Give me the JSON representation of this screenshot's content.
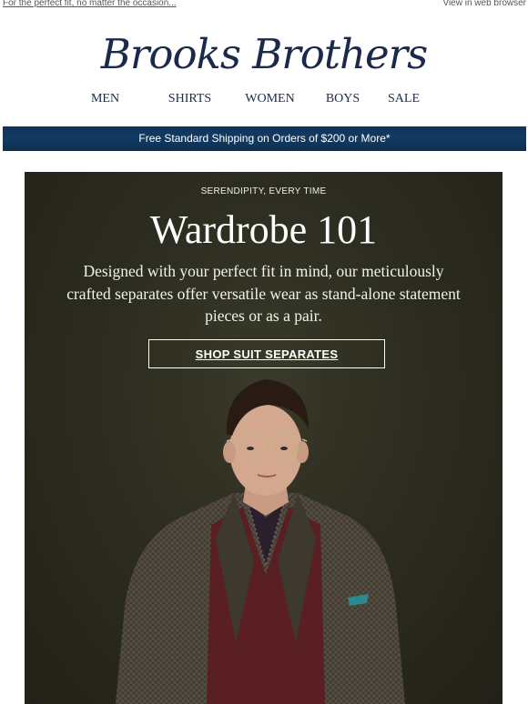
{
  "topbar": {
    "preheader": "For the perfect fit, no matter the occasion...",
    "web_view": "View in web browser"
  },
  "brand": {
    "logo_text": "Brooks Brothers"
  },
  "nav": {
    "items": [
      {
        "label": "MEN"
      },
      {
        "label": "SHIRTS"
      },
      {
        "label": "WOMEN"
      },
      {
        "label": "BOYS"
      },
      {
        "label": "SALE"
      }
    ]
  },
  "banner": {
    "text": "Free Standard Shipping on Orders of $200 or More*"
  },
  "hero": {
    "eyebrow": "SERENDIPITY, EVERY TIME",
    "headline": "Wardrobe 101",
    "body": "Designed with your perfect fit in mind, our meticulously crafted separates offer versatile wear as stand-alone statement pieces or as a pair.",
    "cta_label": "SHOP SUIT SEPARATES"
  },
  "colors": {
    "brand_navy": "#1b2a4a",
    "banner_blue": "#0f3559",
    "hero_bg": "#2c2c20"
  }
}
